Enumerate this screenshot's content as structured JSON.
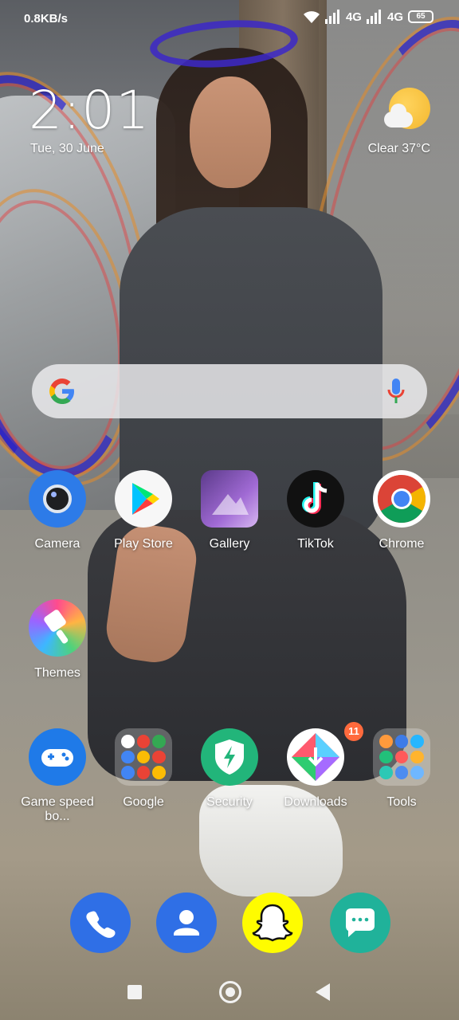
{
  "status_bar": {
    "net_speed": "0.8KB/s",
    "net_type_1": "4G",
    "net_type_2": "4G",
    "battery": "65"
  },
  "clock": {
    "time": "2:01",
    "date": "Tue, 30 June"
  },
  "weather": {
    "text": "Clear  37°C",
    "icon": "partly-sunny-icon"
  },
  "search": {
    "logo": "google-g-icon",
    "mic": "microphone-icon"
  },
  "apps_row1": [
    {
      "label": "Camera"
    },
    {
      "label": "Play Store"
    },
    {
      "label": "Gallery"
    },
    {
      "label": "TikTok"
    },
    {
      "label": "Chrome"
    }
  ],
  "apps_row2": [
    {
      "label": "Themes"
    }
  ],
  "apps_row3": [
    {
      "label": "Game speed bo..."
    },
    {
      "label": "Google"
    },
    {
      "label": "Security"
    },
    {
      "label": "Downloads",
      "badge": "11"
    },
    {
      "label": "Tools"
    }
  ],
  "dock": [
    {
      "name": "Phone",
      "icon": "phone-icon"
    },
    {
      "name": "Contacts",
      "icon": "contacts-icon"
    },
    {
      "name": "Snapchat",
      "icon": "snapchat-ghost-icon"
    },
    {
      "name": "Messaging",
      "icon": "chat-bubble-icon"
    }
  ],
  "nav": {
    "recents": "square-icon",
    "home": "circle-icon",
    "back": "triangle-back-icon"
  },
  "colors": {
    "accent_blue": "#2f6fe6",
    "badge_orange": "#ff6a3d",
    "security_green": "#22b57a",
    "snapchat_yellow": "#fffc00"
  }
}
